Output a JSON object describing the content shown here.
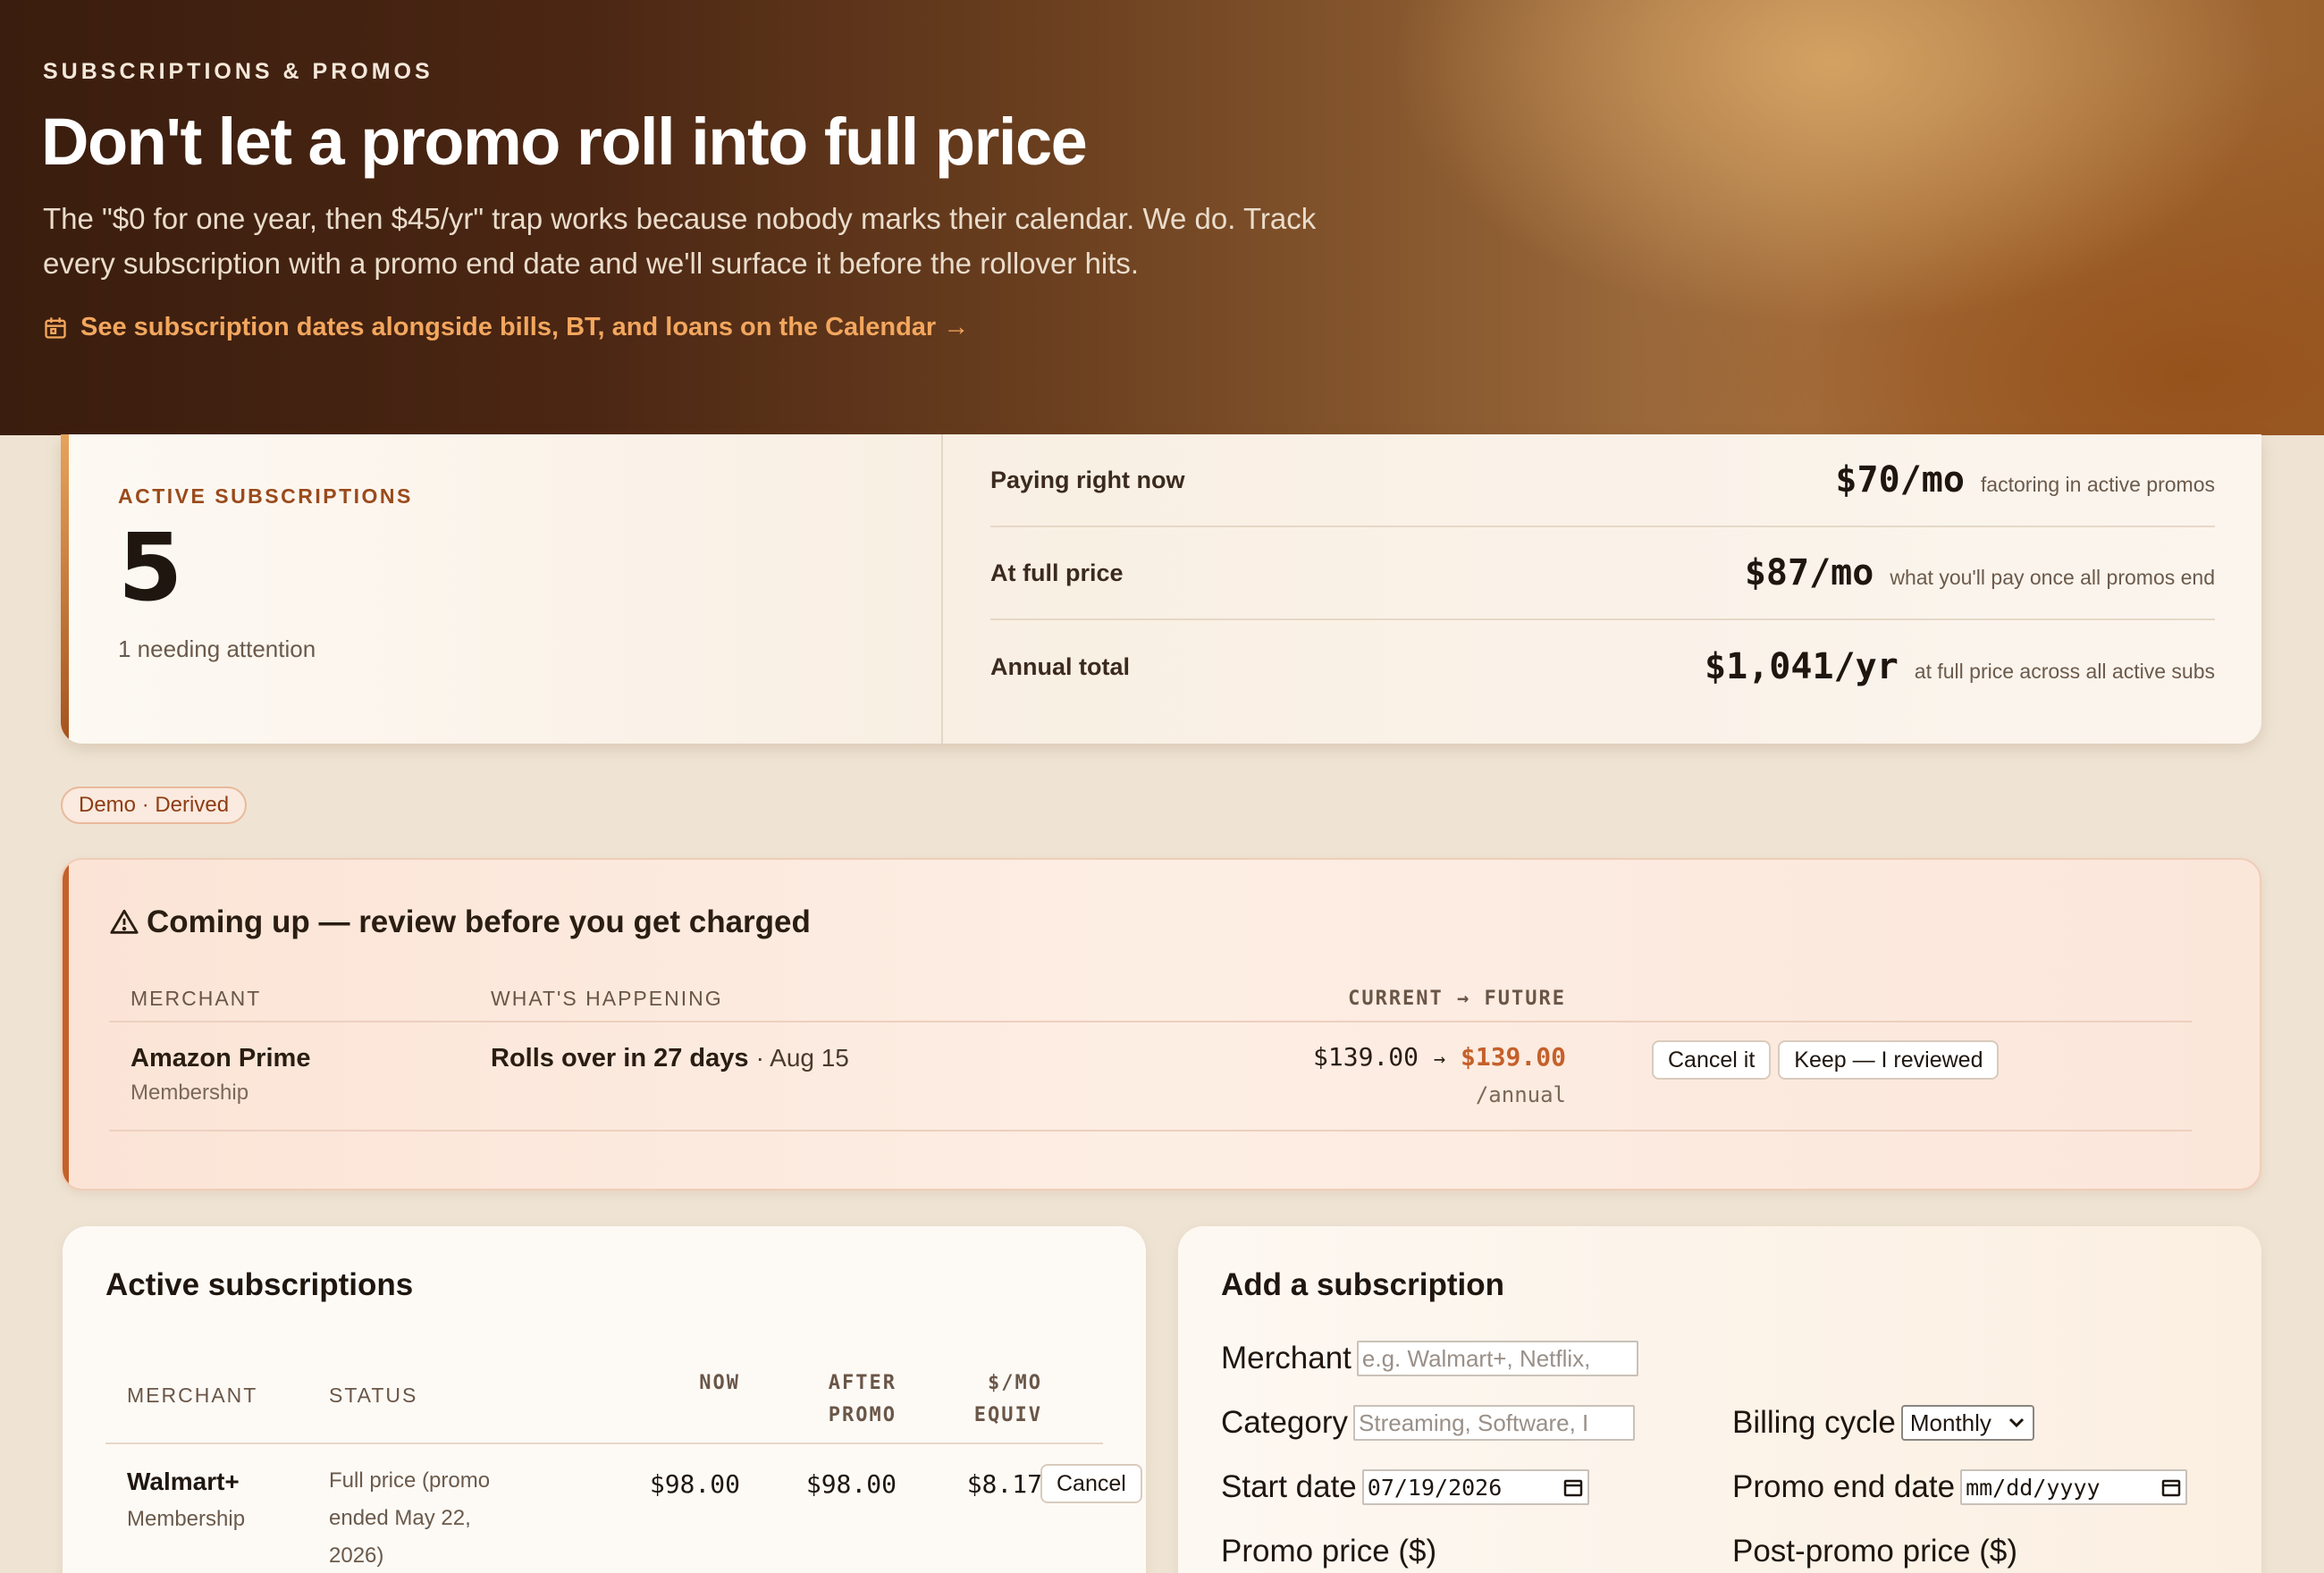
{
  "hero": {
    "eyebrow": "SUBSCRIPTIONS & PROMOS",
    "title": "Don't let a promo roll into full price",
    "description": "The \"$0 for one year, then $45/yr\" trap works because nobody marks their calendar. We do. Track every subscription with a promo end date and we'll surface it before the rollover hits.",
    "calendar_link": "See subscription dates alongside bills, BT, and loans on the Calendar →",
    "calendar_icon": "calendar-icon"
  },
  "stats": {
    "eyebrow": "ACTIVE SUBSCRIPTIONS",
    "count": "5",
    "subtitle": "1 needing attention",
    "rows": [
      {
        "label": "Paying right now",
        "value": "$70/mo",
        "note": "factoring in active promos"
      },
      {
        "label": "At full price",
        "value": "$87/mo",
        "note": "what you'll pay once all promos end"
      },
      {
        "label": "Annual total",
        "value": "$1,041/yr",
        "note": "at full price across all active subs"
      }
    ]
  },
  "badge": "Demo · Derived",
  "alert": {
    "title": "Coming up — review before you get charged",
    "icon": "warning-icon",
    "columns": {
      "merchant": "MERCHANT",
      "what": "WHAT'S HAPPENING",
      "current_future": "CURRENT → FUTURE"
    },
    "rows": [
      {
        "merchant": "Amazon Prime",
        "category": "Membership",
        "what": "Rolls over in 27 days",
        "date": "· Aug 15",
        "current": "$139.00",
        "arrow": "→",
        "future": "$139.00",
        "period": "/annual",
        "cancel_label": "Cancel it",
        "keep_label": "Keep — I reviewed"
      }
    ]
  },
  "active": {
    "title": "Active subscriptions",
    "columns": {
      "merchant": "MERCHANT",
      "status": "STATUS",
      "now": "NOW",
      "after1": "AFTER",
      "after2": "PROMO",
      "equiv1": "$/MO",
      "equiv2": "EQUIV"
    },
    "rows": [
      {
        "merchant": "Walmart+",
        "category": "Membership",
        "status": "Full price (promo ended May 22, 2026)",
        "now": "$98.00",
        "after": "$98.00",
        "equiv": "$8.17",
        "action": "Cancel"
      }
    ]
  },
  "form": {
    "title": "Add a subscription",
    "merchant_label": "Merchant",
    "merchant_placeholder": "e.g. Walmart+, Netflix,",
    "category_label": "Category",
    "category_placeholder": "Streaming, Software, I",
    "billing_label": "Billing cycle",
    "billing_value": "Monthly",
    "start_label": "Start date",
    "start_value": "07/19/2026",
    "promo_end_label": "Promo end date",
    "promo_end_value": "mm/dd/yyyy",
    "promo_price_label": "Promo price ($)",
    "post_promo_label": "Post-promo price ($)"
  },
  "colors": {
    "accent": "#c5602a",
    "link": "#f3a75e",
    "eyebrow": "#9a4a1b"
  }
}
